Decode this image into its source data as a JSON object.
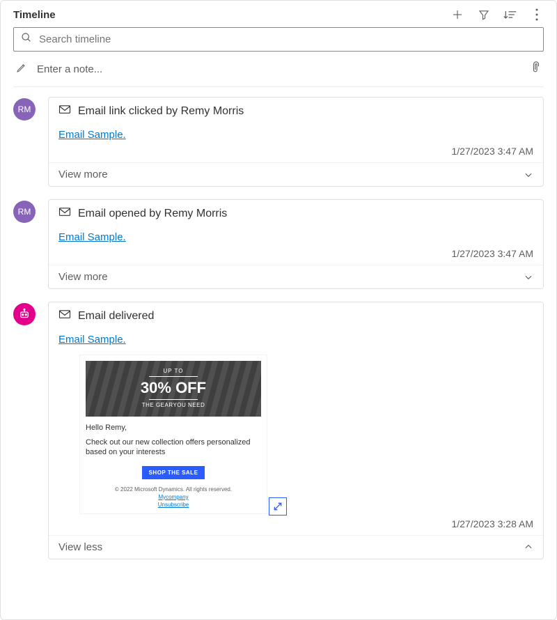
{
  "header": {
    "title": "Timeline"
  },
  "search": {
    "placeholder": "Search timeline"
  },
  "note": {
    "placeholder": "Enter a note..."
  },
  "entries": [
    {
      "avatar_initials": "RM",
      "avatar_style": "purple",
      "title": "Email link clicked by Remy Morris",
      "link_label": "Email Sample.",
      "timestamp": "1/27/2023 3:47 AM",
      "toggle_label": "View more",
      "expanded": false
    },
    {
      "avatar_initials": "RM",
      "avatar_style": "purple",
      "title": "Email opened by Remy Morris",
      "link_label": "Email Sample.",
      "timestamp": "1/27/2023 3:47 AM",
      "toggle_label": "View more",
      "expanded": false
    },
    {
      "avatar_initials": "bot",
      "avatar_style": "magenta",
      "title": "Email delivered",
      "link_label": "Email Sample.",
      "timestamp": "1/27/2023 3:28 AM",
      "toggle_label": "View less",
      "expanded": true,
      "preview": {
        "upto": "UP TO",
        "off": "30% OFF",
        "sub": "THE GEARYOU NEED",
        "hello": "Hello Remy,",
        "body": "Check out our new collection offers personalized based on your interests",
        "cta": "SHOP THE SALE",
        "copyright": "© 2022 Microsoft Dynamics. All rights reserved.",
        "company_link": "Mycompany",
        "unsubscribe_link": "Unsubscribe"
      }
    }
  ]
}
